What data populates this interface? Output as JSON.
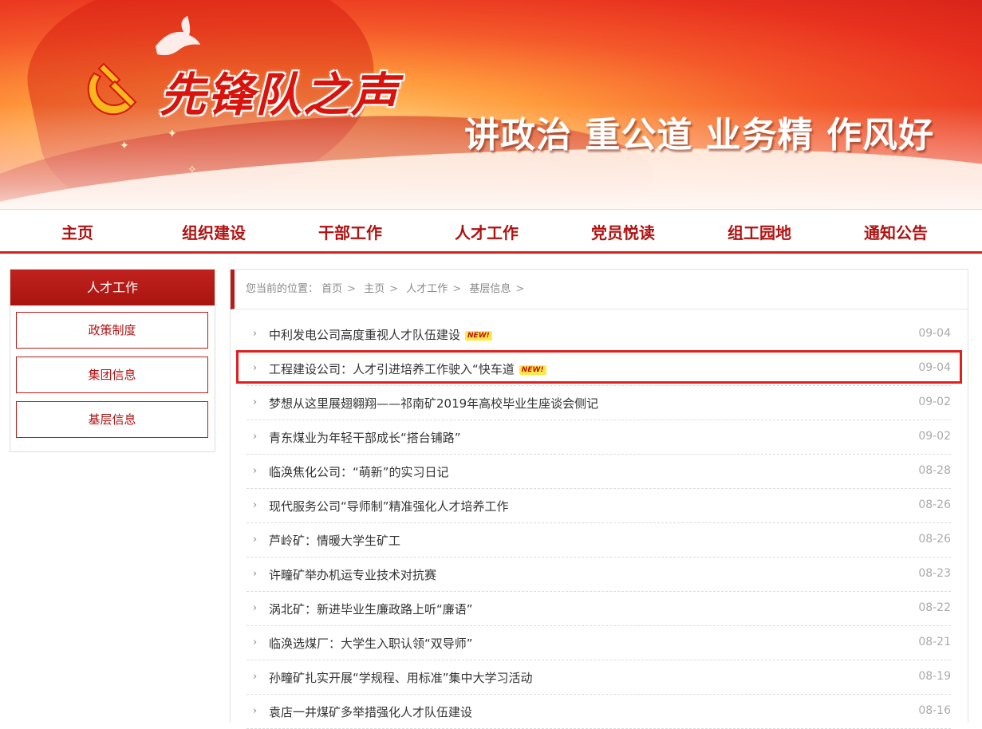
{
  "banner": {
    "logo_text": "先锋队之声",
    "slogan": "讲政治  重公道  业务精  作风好"
  },
  "nav": {
    "items": [
      "主页",
      "组织建设",
      "干部工作",
      "人才工作",
      "党员悦读",
      "组工园地",
      "通知公告"
    ]
  },
  "sidebar": {
    "title": "人才工作",
    "items": [
      "政策制度",
      "集团信息",
      "基层信息"
    ]
  },
  "breadcrumb": {
    "prefix": "您当前的位置：",
    "items": [
      "首页",
      "主页",
      "人才工作",
      "基层信息"
    ],
    "separator": ">"
  },
  "badge_text": "NEW!",
  "news": [
    {
      "title": "中利发电公司高度重视人才队伍建设",
      "date": "09-04",
      "is_new": true
    },
    {
      "title": "工程建设公司：人才引进培养工作驶入“快车道",
      "date": "09-04",
      "is_new": true
    },
    {
      "title": "梦想从这里展翅翱翔——祁南矿2019年高校毕业生座谈会侧记",
      "date": "09-02",
      "is_new": false
    },
    {
      "title": "青东煤业为年轻干部成长“搭台铺路”",
      "date": "09-02",
      "is_new": false
    },
    {
      "title": "临涣焦化公司：“萌新”的实习日记",
      "date": "08-28",
      "is_new": false
    },
    {
      "title": "现代服务公司“导师制”精准强化人才培养工作",
      "date": "08-26",
      "is_new": false
    },
    {
      "title": "芦岭矿：情暖大学生矿工",
      "date": "08-26",
      "is_new": false
    },
    {
      "title": "许疃矿举办机运专业技术对抗赛",
      "date": "08-23",
      "is_new": false
    },
    {
      "title": "涡北矿：新进毕业生廉政路上听“廉语”",
      "date": "08-22",
      "is_new": false
    },
    {
      "title": "临涣选煤厂：大学生入职认领“双导师”",
      "date": "08-21",
      "is_new": false
    },
    {
      "title": "孙疃矿扎实开展“学规程、用标准”集中大学习活动",
      "date": "08-19",
      "is_new": false
    },
    {
      "title": "袁店一井煤矿多举措强化人才队伍建设",
      "date": "08-16",
      "is_new": false
    }
  ],
  "colors": {
    "accent": "#b81c1a",
    "highlight_border": "#e0201e",
    "nav_text": "#b01212"
  }
}
